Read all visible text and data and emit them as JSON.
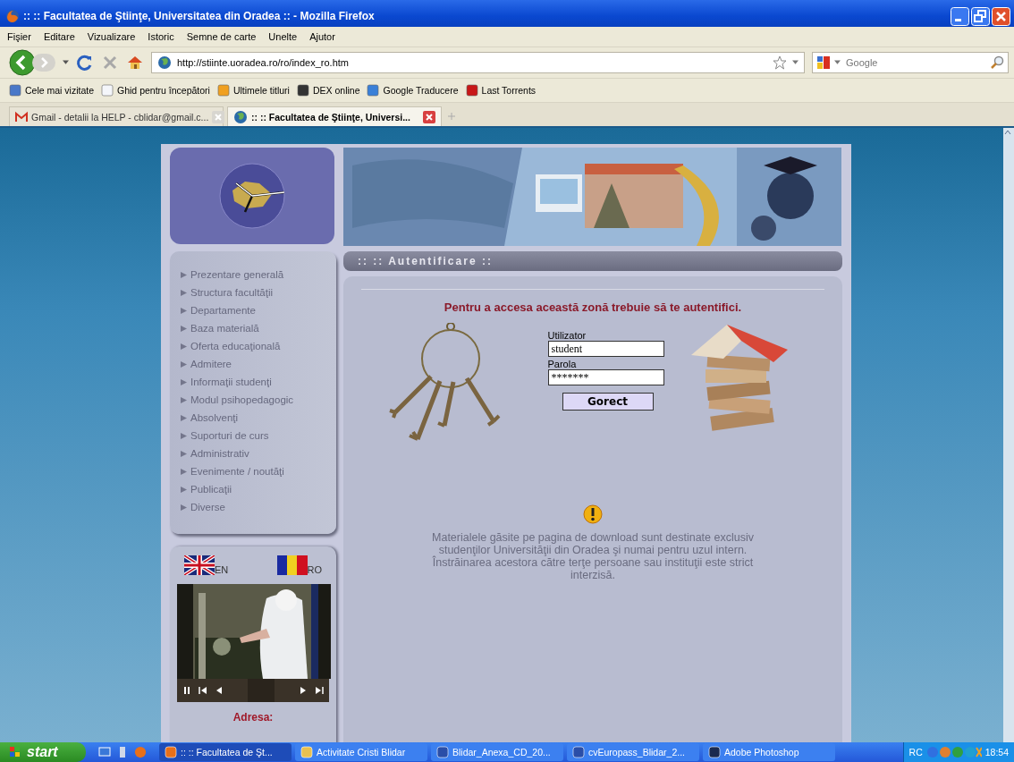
{
  "window": {
    "title": ":: :: Facultatea de Ştiinţe, Universitatea din Oradea :: - Mozilla Firefox"
  },
  "menu": [
    "Fişier",
    "Editare",
    "Vizualizare",
    "Istoric",
    "Semne de carte",
    "Unelte",
    "Ajutor"
  ],
  "address": {
    "value": "http://stiinte.uoradea.ro/ro/index_ro.htm"
  },
  "search": {
    "placeholder": "Google"
  },
  "bookmarks": [
    {
      "kind": "folder",
      "label": "Cele mai vizitate"
    },
    {
      "kind": "page",
      "label": "Ghid pentru începători"
    },
    {
      "kind": "feed",
      "label": "Ultimele titluri"
    },
    {
      "kind": "dex",
      "label": "DEX online"
    },
    {
      "kind": "translate",
      "label": "Google Traducere"
    },
    {
      "kind": "torrent",
      "label": "Last Torrents"
    }
  ],
  "tabs": [
    {
      "kind": "mail",
      "label": "Gmail - detalii la HELP - cblidar@gmail.c...",
      "selected": false
    },
    {
      "kind": "globe",
      "label": ":: :: Facultatea de Ştiinţe, Universi...",
      "selected": true
    }
  ],
  "page": {
    "section_title": ":: :: Autentificare ::",
    "nav": [
      "Prezentare generală",
      "Structura facultăţii",
      "Departamente",
      "Baza materială",
      "Oferta educaţională",
      "Admitere",
      "Informaţii studenţi",
      "Modul psihopedagogic",
      "Absolvenţi",
      "Suporturi de curs",
      "Administrativ",
      "Evenimente / noutăţi",
      "Publicaţii",
      "Diverse"
    ],
    "languages": [
      "EN",
      "RO"
    ],
    "address_label": "Adresa:",
    "login": {
      "heading": "Pentru a accesa această zonă trebuie să te autentifici.",
      "user_label": "Utilizator",
      "user_value": "student",
      "password_label": "Parola",
      "password_value": "*******",
      "button": "Gorect"
    },
    "notice": "Materialele găsite pe pagina de download sunt destinate exclusiv studenţilor Universităţii din Oradea şi numai pentru uzul intern. Înstrăinarea acestora către terţe persoane sau instituţii este strict interzisă."
  },
  "taskbar": {
    "start": "start",
    "tasks": [
      {
        "kind": "firefox",
        "label": ":: :: Facultatea de Şt...",
        "selected": true
      },
      {
        "kind": "folder",
        "label": "Activitate Cristi Blidar",
        "selected": false
      },
      {
        "kind": "word",
        "label": "Blidar_Anexa_CD_20...",
        "selected": false
      },
      {
        "kind": "word",
        "label": "cvEuropass_Blidar_2...",
        "selected": false
      },
      {
        "kind": "photoshop",
        "label": "Adobe Photoshop",
        "selected": false
      }
    ],
    "language": "RC",
    "time": "18:54"
  }
}
